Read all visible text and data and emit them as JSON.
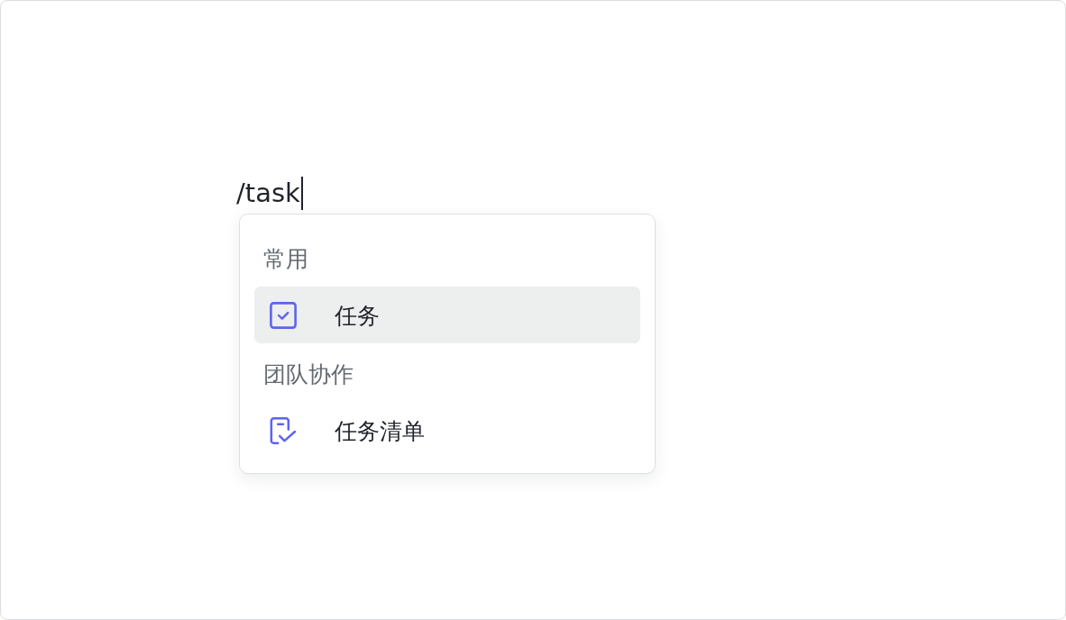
{
  "editor": {
    "text": "/task",
    "focused": true
  },
  "command_menu": {
    "groups": [
      {
        "title": "常用",
        "items": [
          {
            "kind": "task",
            "label": "任务",
            "selected": true
          }
        ]
      },
      {
        "title": "团队协作",
        "items": [
          {
            "kind": "task_list",
            "label": "任务清单",
            "selected": false
          }
        ]
      }
    ]
  }
}
